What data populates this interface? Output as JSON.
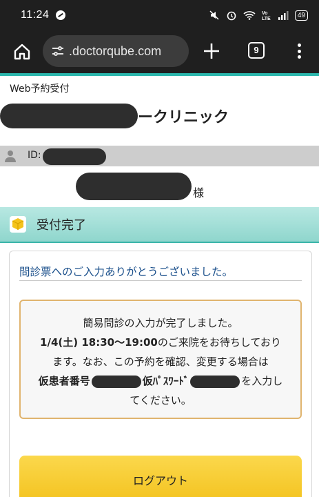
{
  "status_bar": {
    "time": "11:24",
    "battery": "49",
    "icons": [
      "mute-icon",
      "alarm-icon",
      "wifi-icon",
      "volte-icon",
      "signal-icon"
    ]
  },
  "browser": {
    "url": ".doctorqube.com",
    "tab_count": "9"
  },
  "page": {
    "web_label": "Web予約受付",
    "clinic_name_visible": "ークリニック",
    "id_label": "ID:",
    "name_suffix": "様",
    "section_title": "受付完了",
    "thanks_message": "問診票へのご入力ありがとうございました。",
    "notice": {
      "line1": "簡易問診の入力が完了しました。",
      "datetime": "1/4(土) 18:30〜19:00",
      "line2_rest": "のご来院をお待ちしており",
      "line3": "ます。なお、この予約を確認、変更する場合は",
      "patient_no_label": "仮患者番号",
      "password_label": "仮ﾊﾟｽﾜｰﾄﾞ",
      "line4_rest": "を入力し",
      "line5": "てください。"
    },
    "logout_label": "ログアウト"
  },
  "colors": {
    "accent_teal": "#2bb7ad",
    "notice_border": "#e0b46e",
    "logout_yellow": "#f3c21e",
    "thanks_blue": "#1a4f8b"
  }
}
